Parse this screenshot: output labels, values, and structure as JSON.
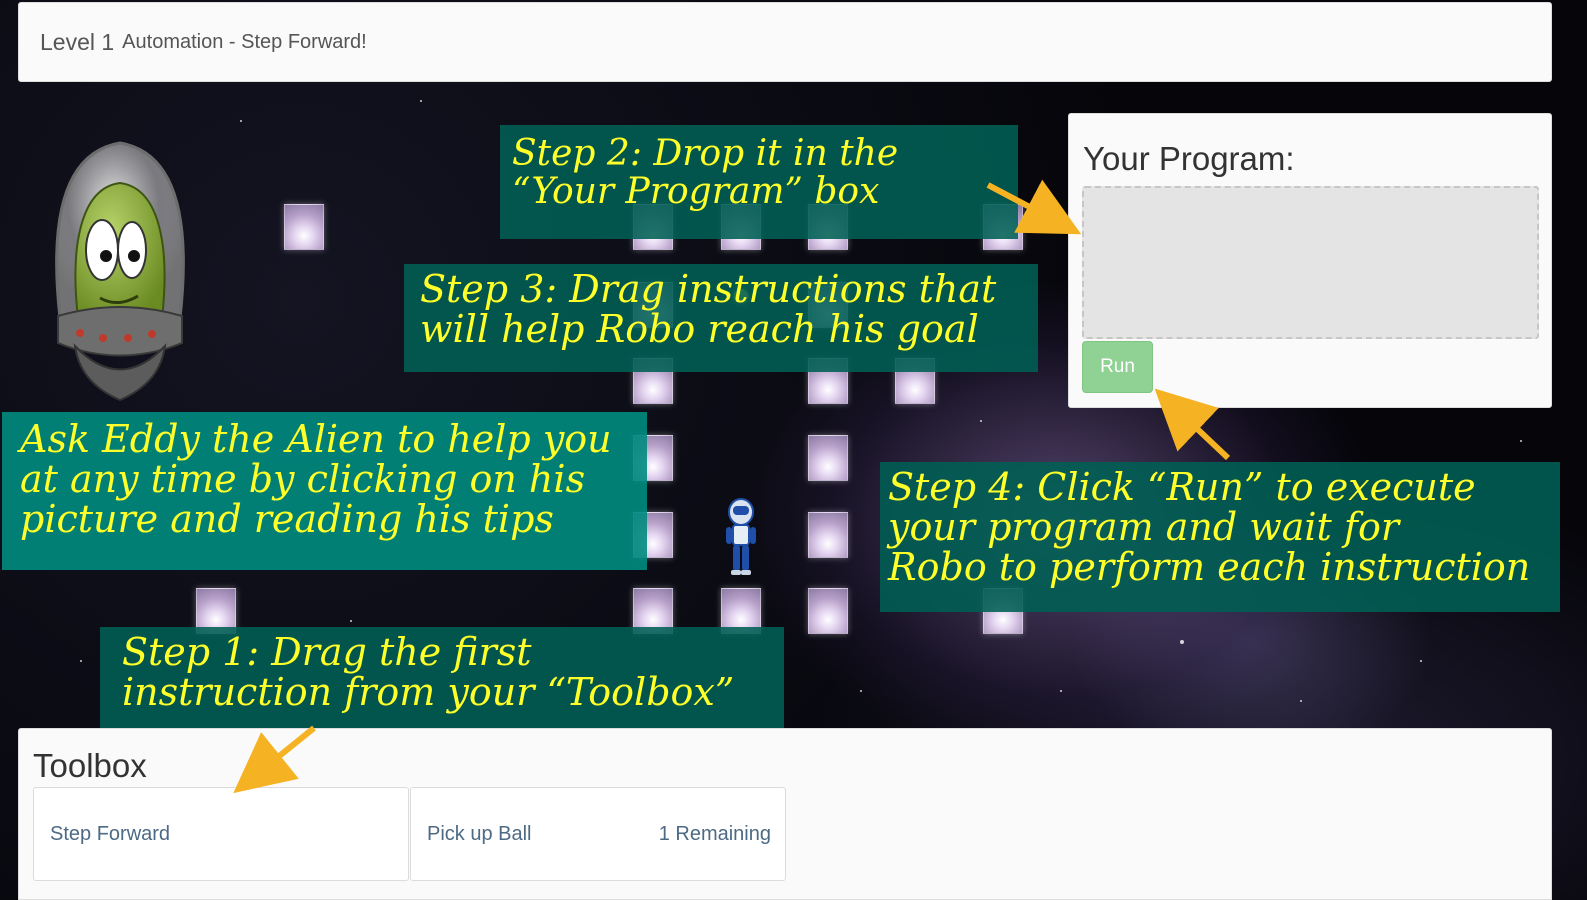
{
  "header": {
    "level": "Level 1",
    "title": "Automation - Step Forward!"
  },
  "callouts": {
    "step2": [
      "Step 2: Drop it in the",
      "“Your Program” box"
    ],
    "step3": [
      "Step 3: Drag instructions that",
      "will help Robo reach his goal"
    ],
    "eddy": [
      "Ask Eddy the Alien to help you",
      "at any time by clicking on his",
      "picture and reading his tips"
    ],
    "step4": [
      "Step 4: Click “Run” to execute",
      "your program and wait for",
      "Robo to perform each instruction"
    ],
    "step1": [
      "Step 1: Drag the first",
      " instruction from your “Toolbox”"
    ]
  },
  "program": {
    "title": "Your Program:",
    "run_label": "Run"
  },
  "toolbox": {
    "title": "Toolbox",
    "items": [
      {
        "label": "Step Forward",
        "remaining": ""
      },
      {
        "label": "Pick up Ball",
        "remaining": "1 Remaining"
      }
    ]
  },
  "colors": {
    "callout_text": "#ffff2a",
    "callout_bg": "#006054",
    "arrow": "#f5b324",
    "run_button": "#8fd293"
  },
  "icons": {
    "alien": "eddy-alien-icon",
    "robot": "robo-robot-icon",
    "ball": "ball-icon"
  }
}
